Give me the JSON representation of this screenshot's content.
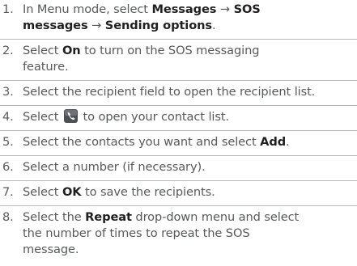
{
  "steps": [
    {
      "num": "1.",
      "line1": {
        "t1": "In Menu mode, select ",
        "b1": "Messages",
        "t2": " → ",
        "b2": "SOS"
      },
      "line2": {
        "b1": "messages",
        "t1": " → ",
        "b2": "Sending options",
        "t2": "."
      }
    },
    {
      "num": "2.",
      "line1": {
        "t1": "Select ",
        "b1": "On",
        "t2": " to turn on the SOS messaging"
      },
      "line2": {
        "t1": "feature."
      }
    },
    {
      "num": "3.",
      "line1": {
        "t1": "Select the recipient field to open the recipient list."
      }
    },
    {
      "num": "4.",
      "line1": {
        "t1": "Select ",
        "t2": " to open your contact list."
      }
    },
    {
      "num": "5.",
      "line1": {
        "t1": "Select the contacts you want and select ",
        "b1": "Add",
        "t2": "."
      }
    },
    {
      "num": "6.",
      "line1": {
        "t1": "Select a number (if necessary)."
      }
    },
    {
      "num": "7.",
      "line1": {
        "t1": "Select ",
        "b1": "OK",
        "t2": " to save the recipients."
      }
    },
    {
      "num": "8.",
      "line1": {
        "t1": "Select the ",
        "b1": "Repeat",
        "t2": " drop-down menu and select"
      },
      "line2": {
        "t1": "the number of times to repeat the SOS"
      },
      "line3": {
        "t1": "message."
      }
    }
  ],
  "icon": "phonebook-icon",
  "colors": {
    "text": "#58595b",
    "bold": "#231f20",
    "divider": "#b7b8ba",
    "icon_bg": "#4d5156"
  }
}
